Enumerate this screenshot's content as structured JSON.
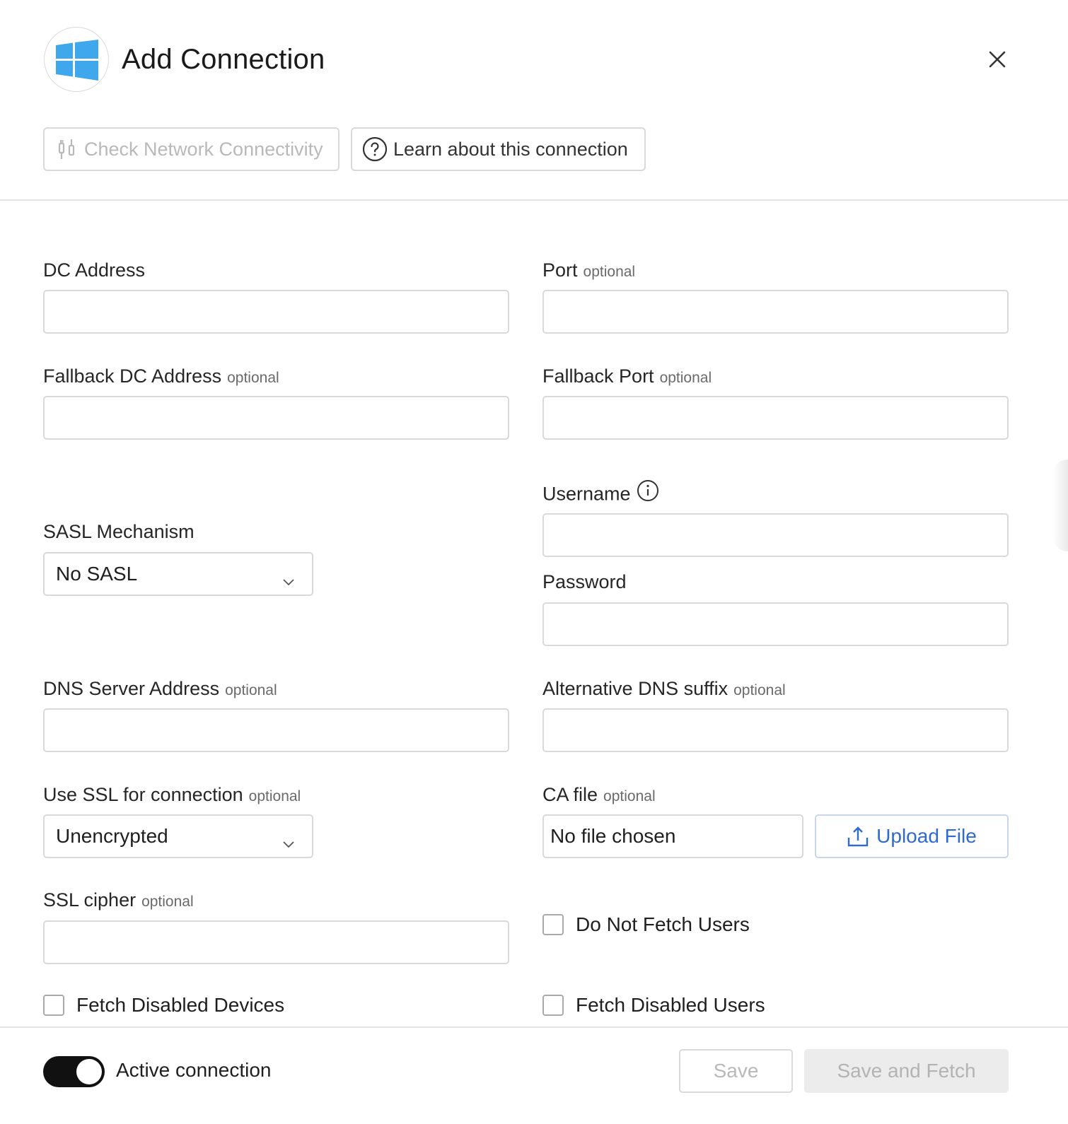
{
  "header": {
    "title": "Add Connection",
    "logo_icon": "windows-logo-icon",
    "close_icon": "close-icon"
  },
  "toolbar": {
    "check_network": "Check Network Connectivity",
    "learn_about": "Learn about this connection"
  },
  "form": {
    "optional_tag": "optional",
    "dc_address": {
      "label": "DC Address",
      "value": ""
    },
    "port": {
      "label": "Port",
      "value": ""
    },
    "fallback_dc_address": {
      "label": "Fallback DC Address",
      "value": ""
    },
    "fallback_port": {
      "label": "Fallback Port",
      "value": ""
    },
    "username": {
      "label": "Username",
      "value": ""
    },
    "password": {
      "label": "Password",
      "value": ""
    },
    "sasl": {
      "label": "SASL Mechanism",
      "selected": "No SASL"
    },
    "dns_server": {
      "label": "DNS Server Address",
      "value": ""
    },
    "alt_dns_suffix": {
      "label": "Alternative DNS suffix",
      "value": ""
    },
    "use_ssl": {
      "label": "Use SSL for connection",
      "selected": "Unencrypted"
    },
    "ca_file": {
      "label": "CA file",
      "file_status": "No file chosen",
      "upload_label": "Upload File"
    },
    "ssl_cipher": {
      "label": "SSL cipher",
      "value": ""
    },
    "checkboxes": {
      "do_not_fetch_users": {
        "label": "Do Not Fetch Users",
        "checked": false
      },
      "fetch_disabled_devices": {
        "label": "Fetch Disabled Devices",
        "checked": false
      },
      "fetch_disabled_users": {
        "label": "Fetch Disabled Users",
        "checked": false
      }
    }
  },
  "footer": {
    "active_connection_label": "Active connection",
    "active_connection_on": true,
    "save_label": "Save",
    "save_fetch_label": "Save and Fetch"
  },
  "colors": {
    "accent_blue": "#2f6ad0",
    "windows_blue": "#3fa7ec",
    "toggle_on": "#111111",
    "border": "#d9d9d9"
  }
}
